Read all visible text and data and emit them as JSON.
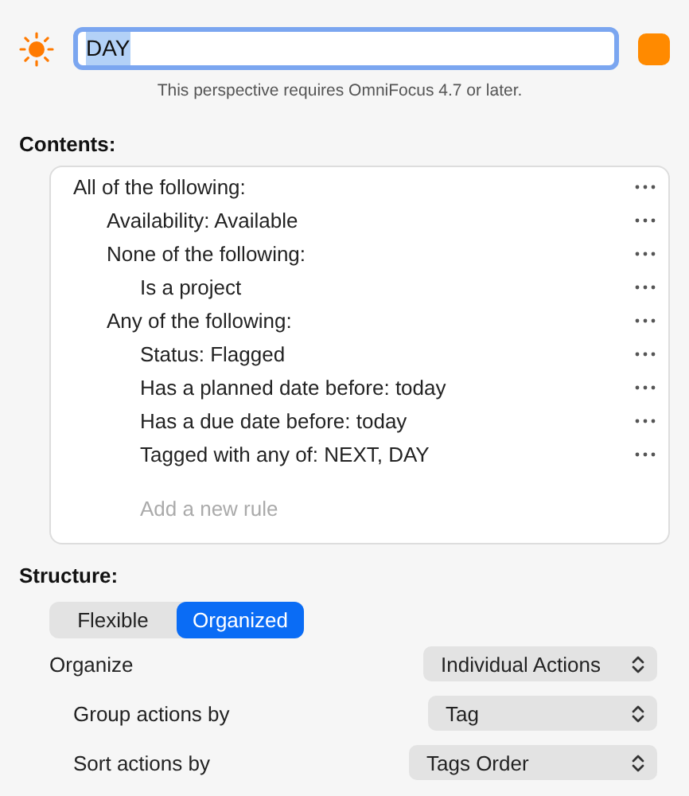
{
  "header": {
    "name": "DAY",
    "name_selected": true,
    "color": "#ff8a00",
    "notice": "This perspective requires OmniFocus 4.7 or later."
  },
  "contents": {
    "label": "Contents:",
    "rules": [
      {
        "text": "All of the following:",
        "children": [
          {
            "text": "Availability: Available"
          },
          {
            "text": "None of the following:",
            "children": [
              {
                "text": "Is a project"
              }
            ]
          },
          {
            "text": "Any of the following:",
            "children": [
              {
                "text": "Status: Flagged"
              },
              {
                "text": "Has a planned date before: today"
              },
              {
                "text": "Has a due date before: today"
              },
              {
                "text": "Tagged with any of: NEXT, DAY"
              }
            ]
          }
        ]
      }
    ],
    "add_placeholder": "Add a new rule"
  },
  "structure": {
    "label": "Structure:",
    "segments": [
      {
        "label": "Flexible",
        "selected": false
      },
      {
        "label": "Organized",
        "selected": true
      }
    ],
    "settings": [
      {
        "label": "Organize",
        "value": "Individual Actions",
        "indented": false
      },
      {
        "label": "Group actions by",
        "value": "Tag",
        "indented": true
      },
      {
        "label": "Sort actions by",
        "value": "Tags Order",
        "indented": true
      }
    ]
  }
}
